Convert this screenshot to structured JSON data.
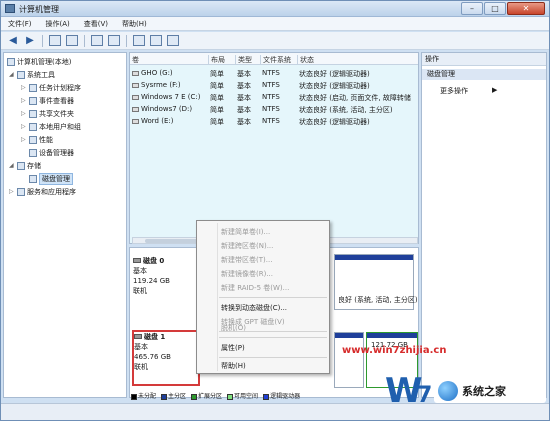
{
  "window": {
    "title": "计算机管理"
  },
  "menu": [
    "文件(F)",
    "操作(A)",
    "查看(V)",
    "帮助(H)"
  ],
  "tree": {
    "root": "计算机管理(本地)",
    "system_tools": "系统工具",
    "task_scheduler": "任务计划程序",
    "event_viewer": "事件查看器",
    "shared_folders": "共享文件夹",
    "local_users": "本地用户和组",
    "performance": "性能",
    "device_manager": "设备管理器",
    "storage": "存储",
    "disk_management": "磁盘管理",
    "services": "服务和应用程序"
  },
  "volume_list": {
    "headers": [
      "卷",
      "布局",
      "类型",
      "文件系统",
      "状态"
    ],
    "rows": [
      {
        "name": "GHO (G:)",
        "layout": "简单",
        "type": "基本",
        "fs": "NTFS",
        "status": "状态良好 (逻辑驱动器)"
      },
      {
        "name": "Sysrme (F:)",
        "layout": "简单",
        "type": "基本",
        "fs": "NTFS",
        "status": "状态良好 (逻辑驱动器)"
      },
      {
        "name": "Windows 7 E (C:)",
        "layout": "简单",
        "type": "基本",
        "fs": "NTFS",
        "status": "状态良好 (启动, 页面文件, 故障转储"
      },
      {
        "name": "Windows7 (D:)",
        "layout": "简单",
        "type": "基本",
        "fs": "NTFS",
        "status": "状态良好 (系统, 活动, 主分区)"
      },
      {
        "name": "Word (E:)",
        "layout": "简单",
        "type": "基本",
        "fs": "NTFS",
        "status": "状态良好 (逻辑驱动器)"
      }
    ]
  },
  "disks": [
    {
      "name": "磁盘 0",
      "type": "基本",
      "size": "119.24 GB",
      "state": "联机",
      "partition_info": "良好 (系统, 活动, 主分区)"
    },
    {
      "name": "磁盘 1",
      "type": "基本",
      "size": "465.76 GB",
      "state": "联机",
      "partition_size": "121.72 GB"
    }
  ],
  "context_menu": {
    "items": [
      {
        "label": "新建简单卷(I)...",
        "enabled": false
      },
      {
        "label": "新建跨区卷(N)...",
        "enabled": false
      },
      {
        "label": "新建带区卷(T)...",
        "enabled": false
      },
      {
        "label": "新建镜像卷(R)...",
        "enabled": false
      },
      {
        "label": "新建 RAID-5 卷(W)...",
        "enabled": false
      },
      {
        "label": "转换到动态磁盘(C)...",
        "enabled": true
      },
      {
        "label": "转换成 GPT 磁盘(V)",
        "enabled": false
      },
      {
        "label": "脱机(O)",
        "enabled": false
      },
      {
        "label": "属性(P)",
        "enabled": true
      },
      {
        "label": "帮助(H)",
        "enabled": true
      }
    ]
  },
  "legend": [
    "未分配",
    "主分区",
    "扩展分区",
    "可用空间",
    "逻辑驱动器"
  ],
  "legend_colors": [
    "#000000",
    "#1f3f9a",
    "#2e9a2e",
    "#7fe07f",
    "#1f3fd6"
  ],
  "actions": {
    "header": "操作",
    "section": "磁盘管理",
    "more": "更多操作"
  },
  "watermark": {
    "url": "www.win7zhijia.cn",
    "site": "系统之家"
  },
  "colors": {
    "highlight": "#d43a3a",
    "disk_cap": "#1f3f9a",
    "selected": "#cfe3f7"
  }
}
